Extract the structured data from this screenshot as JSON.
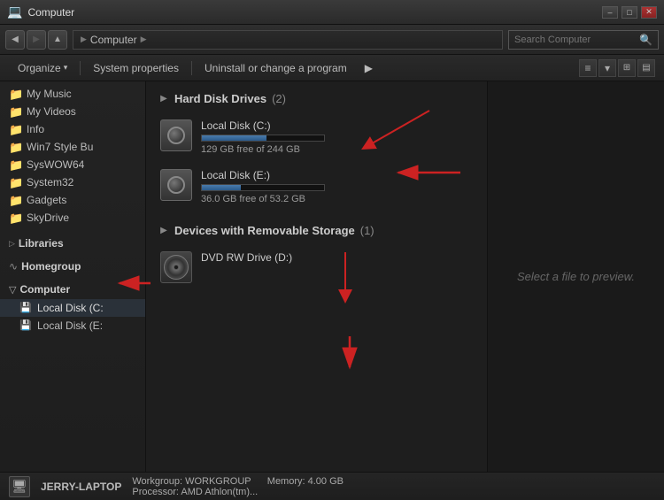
{
  "window": {
    "title": "Computer",
    "minimize": "–",
    "restore": "□",
    "close": "✕"
  },
  "addressbar": {
    "breadcrumb_label": "Computer",
    "breadcrumb_arrow": "▶",
    "search_placeholder": "Search Computer",
    "search_icon": "🔍"
  },
  "toolbar": {
    "organize_label": "Organize",
    "organize_arrow": "▾",
    "system_properties_label": "System properties",
    "uninstall_label": "Uninstall or change a program",
    "more_arrow": "▶"
  },
  "sidebar": {
    "items": [
      {
        "id": "my-music",
        "label": "My Music",
        "icon": "♪"
      },
      {
        "id": "my-videos",
        "label": "My Videos",
        "icon": "▶"
      },
      {
        "id": "info",
        "label": "Info",
        "icon": "ℹ"
      },
      {
        "id": "win7-style",
        "label": "Win7 Style Bu",
        "icon": "📁"
      },
      {
        "id": "syswow64",
        "label": "SysWOW64",
        "icon": "📁"
      },
      {
        "id": "system32",
        "label": "System32",
        "icon": "📁"
      },
      {
        "id": "gadgets",
        "label": "Gadgets",
        "icon": "📁"
      },
      {
        "id": "skydrive",
        "label": "SkyDrive",
        "icon": "📁"
      }
    ],
    "sections": [
      {
        "id": "libraries",
        "label": "Libraries",
        "icon": "📚"
      },
      {
        "id": "homegroup",
        "label": "Homegroup",
        "icon": "∿"
      },
      {
        "id": "computer",
        "label": "Computer",
        "icon": "💻"
      },
      {
        "id": "local-disk-c",
        "label": "Local Disk (C:",
        "icon": "💾"
      },
      {
        "id": "local-disk-e",
        "label": "Local Disk (E:",
        "icon": "💾"
      }
    ]
  },
  "content": {
    "hard_disk_section": "Hard Disk Drives",
    "hard_disk_count": "(2)",
    "removable_section": "Devices with Removable Storage",
    "removable_count": "(1)",
    "drives": [
      {
        "id": "local-c",
        "name": "Local Disk (C:)",
        "free": "129 GB free of 244 GB",
        "bar_pct": 47,
        "type": "hdd"
      },
      {
        "id": "local-e",
        "name": "Local Disk (E:)",
        "free": "36.0 GB free of 53.2 GB",
        "bar_pct": 32,
        "type": "hdd"
      }
    ],
    "removable_drives": [
      {
        "id": "dvd-d",
        "name": "DVD RW Drive (D:)",
        "type": "dvd"
      }
    ],
    "preview_text": "Select a file to preview."
  },
  "statusbar": {
    "computer_name": "JERRY-LAPTOP",
    "workgroup_label": "Workgroup: WORKGROUP",
    "memory_label": "Memory: 4.00 GB",
    "processor_label": "Processor: AMD Athlon(tm)..."
  }
}
